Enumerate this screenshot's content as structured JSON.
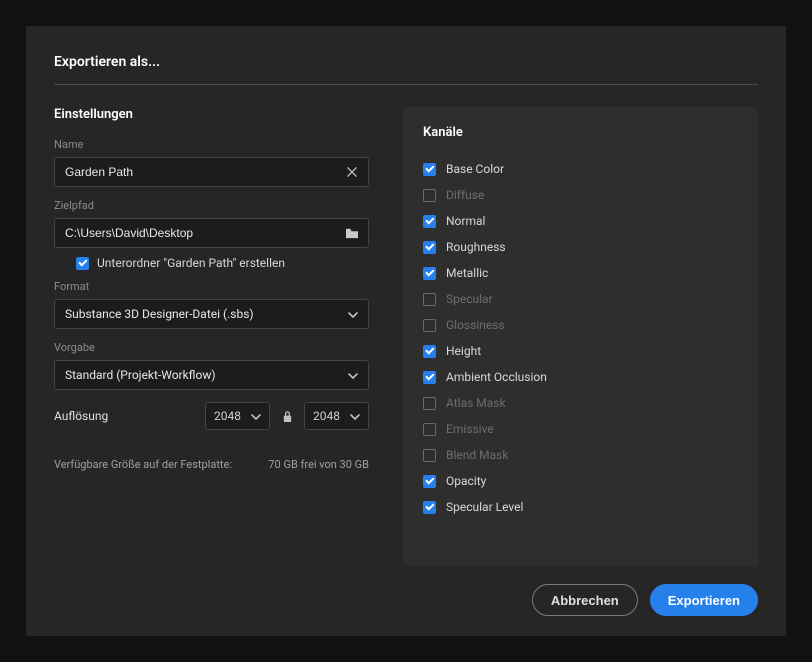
{
  "title": "Exportieren als...",
  "settings": {
    "heading": "Einstellungen",
    "name_label": "Name",
    "name_value": "Garden Path",
    "target_label": "Zielpfad",
    "target_value": "C:\\Users\\David\\Desktop",
    "subfolder_label": "Unterordner \"Garden Path\" erstellen",
    "subfolder_checked": true,
    "format_label": "Format",
    "format_value": "Substance 3D Designer-Datei (.sbs)",
    "preset_label": "Vorgabe",
    "preset_value": "Standard (Projekt-Workflow)",
    "resolution_label": "Auflösung",
    "resolution_w": "2048",
    "resolution_h": "2048",
    "disk_label": "Verfügbare Größe auf der Festplatte:",
    "disk_value": "70 GB frei von 30 GB"
  },
  "channels": {
    "heading": "Kanäle",
    "items": [
      {
        "label": "Base Color",
        "checked": true
      },
      {
        "label": "Diffuse",
        "checked": false
      },
      {
        "label": "Normal",
        "checked": true
      },
      {
        "label": "Roughness",
        "checked": true
      },
      {
        "label": "Metallic",
        "checked": true
      },
      {
        "label": "Specular",
        "checked": false
      },
      {
        "label": "Glossiness",
        "checked": false
      },
      {
        "label": "Height",
        "checked": true
      },
      {
        "label": "Ambient Occlusion",
        "checked": true
      },
      {
        "label": "Atlas Mask",
        "checked": false
      },
      {
        "label": "Emissive",
        "checked": false
      },
      {
        "label": "Blend Mask",
        "checked": false
      },
      {
        "label": "Opacity",
        "checked": true
      },
      {
        "label": "Specular Level",
        "checked": true
      }
    ]
  },
  "footer": {
    "cancel": "Abbrechen",
    "export": "Exportieren"
  }
}
